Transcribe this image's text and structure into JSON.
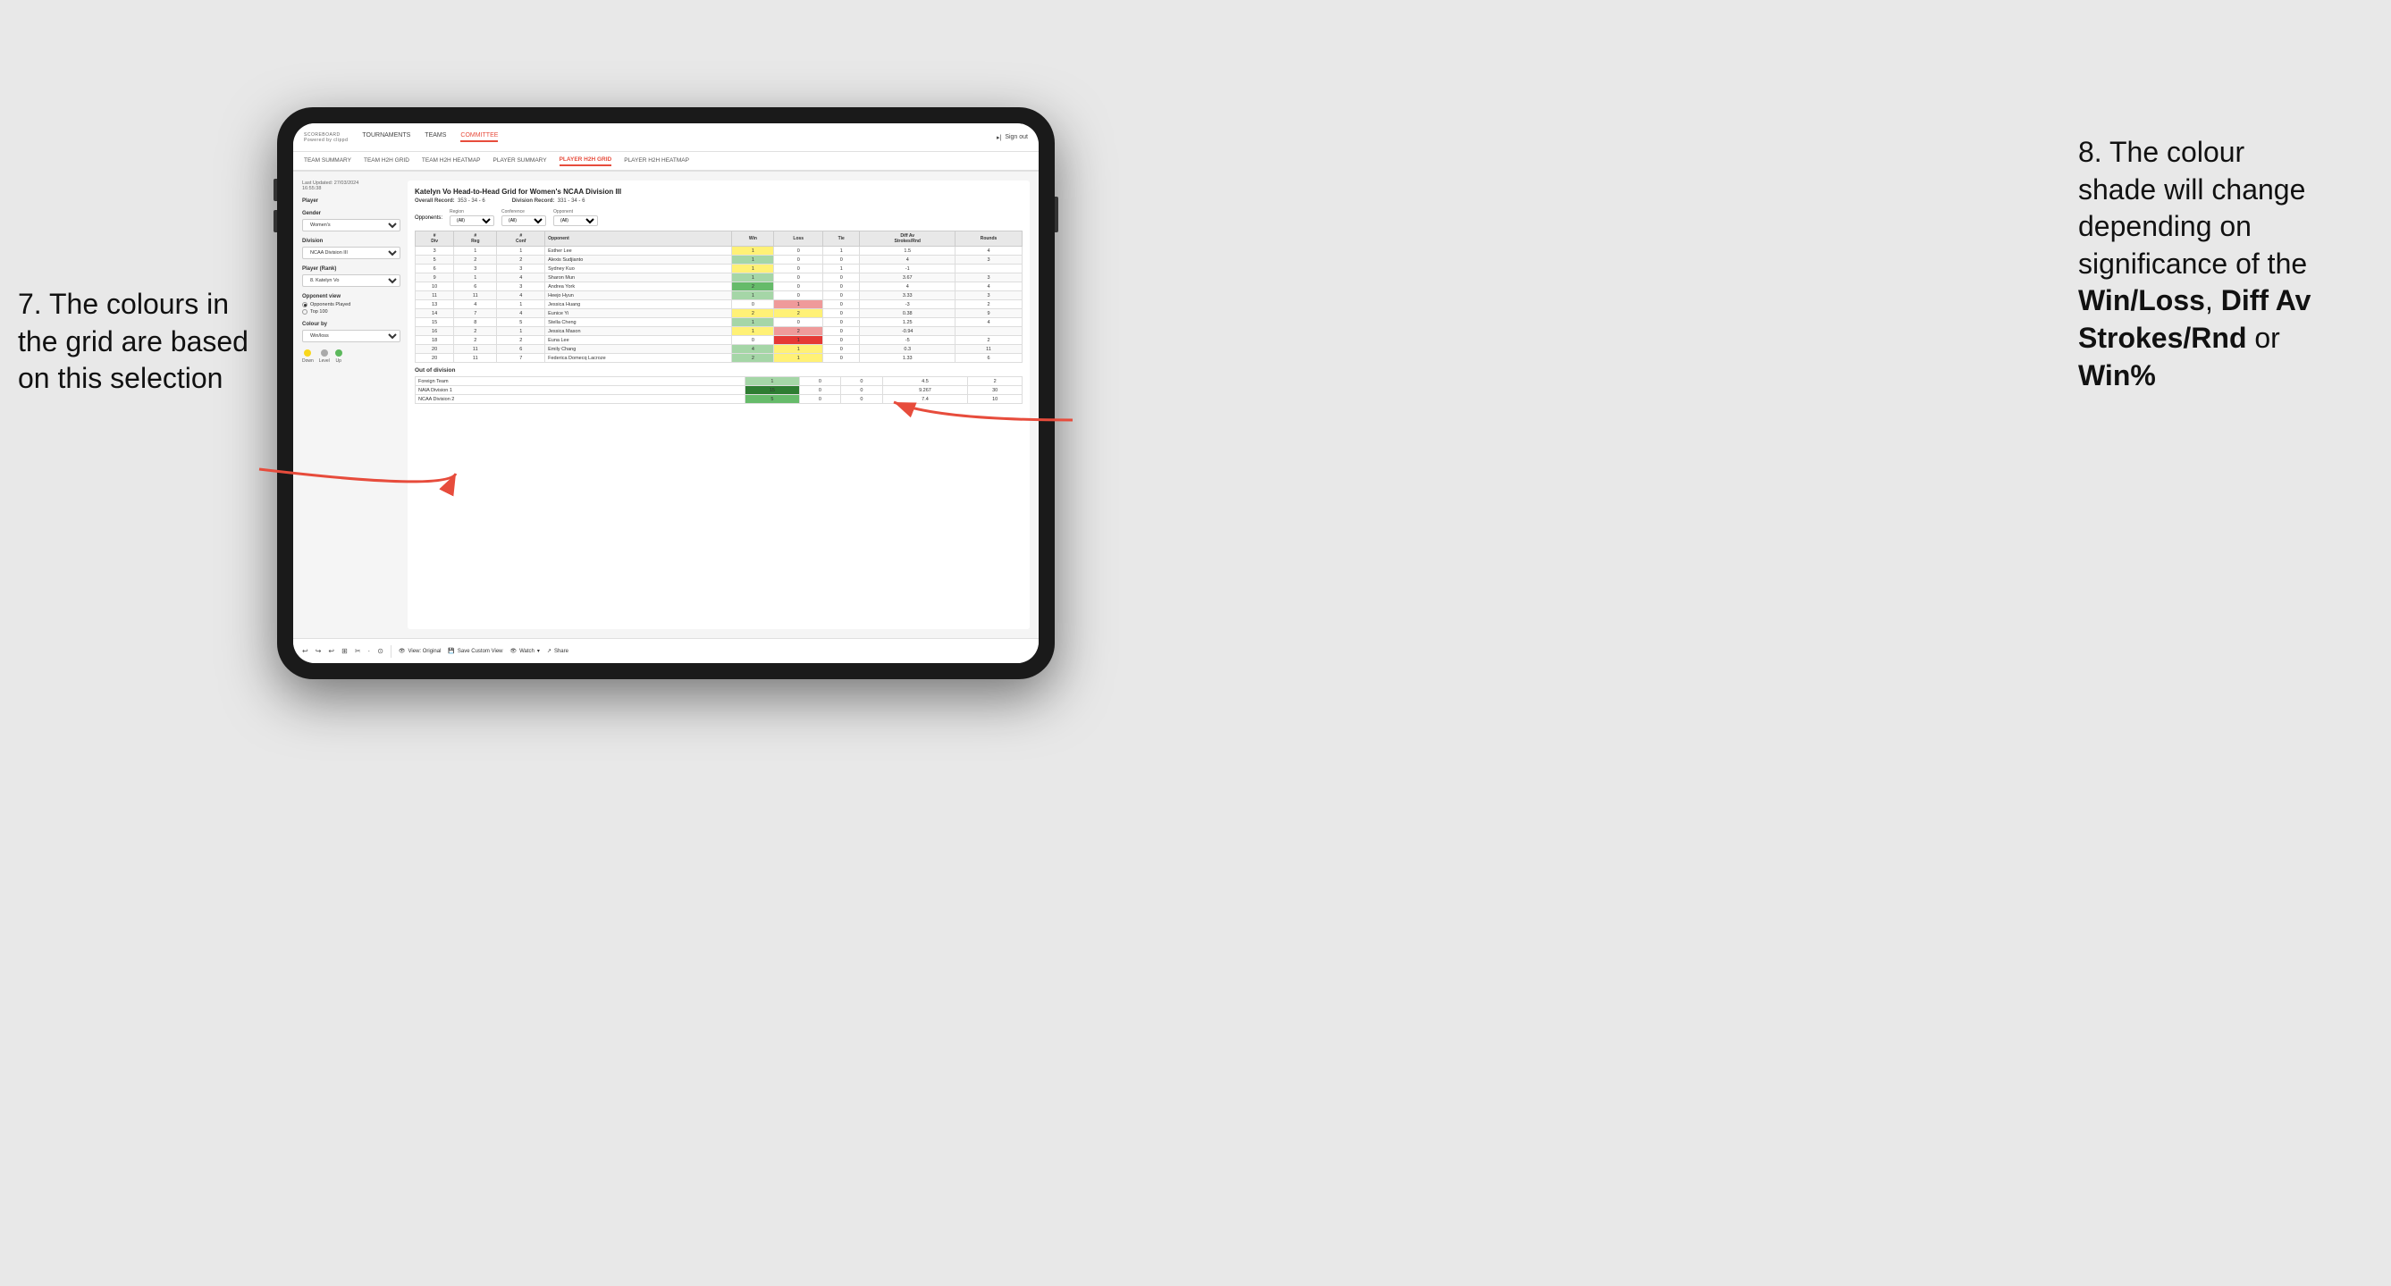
{
  "annotations": {
    "left": {
      "line1": "7. The colours in",
      "line2": "the grid are based",
      "line3": "on this selection"
    },
    "right": {
      "line1": "8. The colour",
      "line2": "shade will change",
      "line3": "depending on",
      "line4": "significance of the",
      "win_loss": "Win/Loss",
      "comma1": ", ",
      "diff": "Diff Av",
      "strokes": "Strokes/Rnd",
      "or": " or",
      "win_pct": "Win%"
    }
  },
  "nav": {
    "logo": "SCOREBOARD",
    "logo_sub": "Powered by clippd",
    "links": [
      "TOURNAMENTS",
      "TEAMS",
      "COMMITTEE"
    ],
    "active_link": "COMMITTEE",
    "sign_out": "Sign out"
  },
  "sub_nav": {
    "items": [
      "TEAM SUMMARY",
      "TEAM H2H GRID",
      "TEAM H2H HEATMAP",
      "PLAYER SUMMARY",
      "PLAYER H2H GRID",
      "PLAYER H2H HEATMAP"
    ],
    "active": "PLAYER H2H GRID"
  },
  "left_panel": {
    "last_updated_label": "Last Updated: 27/03/2024",
    "last_updated_time": "16:55:38",
    "player_label": "Player",
    "gender_label": "Gender",
    "gender_value": "Women's",
    "division_label": "Division",
    "division_value": "NCAA Division III",
    "player_rank_label": "Player (Rank)",
    "player_rank_value": "8. Katelyn Vo",
    "opponent_view_label": "Opponent view",
    "radio_options": [
      "Opponents Played",
      "Top 100"
    ],
    "selected_radio": "Opponents Played",
    "colour_by_label": "Colour by",
    "colour_by_value": "Win/loss",
    "legend": {
      "down_color": "#f9d71c",
      "level_color": "#aaaaaa",
      "up_color": "#5cb85c",
      "down_label": "Down",
      "level_label": "Level",
      "up_label": "Up"
    }
  },
  "grid": {
    "title": "Katelyn Vo Head-to-Head Grid for Women's NCAA Division III",
    "overall_record_label": "Overall Record:",
    "overall_record": "353 - 34 - 6",
    "division_record_label": "Division Record:",
    "division_record": "331 - 34 - 6",
    "filter_region_label": "Region",
    "filter_region_value": "(All)",
    "filter_conference_label": "Conference",
    "filter_conference_value": "(All)",
    "filter_opponent_label": "Opponent",
    "filter_opponent_value": "(All)",
    "opponents_label": "Opponents:",
    "table_headers": {
      "div": "#\nDiv",
      "reg": "#\nReg",
      "conf": "#\nConf",
      "opponent": "Opponent",
      "win": "Win",
      "loss": "Loss",
      "tie": "Tie",
      "diff_av": "Diff Av\nStrokes/Rnd",
      "rounds": "Rounds"
    },
    "rows": [
      {
        "div": 3,
        "reg": 1,
        "conf": 1,
        "opponent": "Esther Lee",
        "win": 1,
        "loss": 0,
        "tie": 1,
        "diff": 1.5,
        "rounds": 4,
        "win_class": "cell-yellow",
        "loss_class": "cell-white",
        "tie_class": "cell-white"
      },
      {
        "div": 5,
        "reg": 2,
        "conf": 2,
        "opponent": "Alexis Sudjianto",
        "win": 1,
        "loss": 0,
        "tie": 0,
        "diff": 4.0,
        "rounds": 3,
        "win_class": "cell-green-light",
        "loss_class": "cell-white",
        "tie_class": "cell-white"
      },
      {
        "div": 6,
        "reg": 3,
        "conf": 3,
        "opponent": "Sydney Kuo",
        "win": 1,
        "loss": 0,
        "tie": 1,
        "diff": -1.0,
        "rounds": "",
        "win_class": "cell-yellow",
        "loss_class": "cell-white",
        "tie_class": "cell-white"
      },
      {
        "div": 9,
        "reg": 1,
        "conf": 4,
        "opponent": "Sharon Mun",
        "win": 1,
        "loss": 0,
        "tie": 0,
        "diff": 3.67,
        "rounds": 3,
        "win_class": "cell-green-light",
        "loss_class": "cell-white",
        "tie_class": "cell-white"
      },
      {
        "div": 10,
        "reg": 6,
        "conf": 3,
        "opponent": "Andrea York",
        "win": 2,
        "loss": 0,
        "tie": 0,
        "diff": 4.0,
        "rounds": 4,
        "win_class": "cell-green-medium",
        "loss_class": "cell-white",
        "tie_class": "cell-white"
      },
      {
        "div": 11,
        "reg": 11,
        "conf": 4,
        "opponent": "Heejo Hyun",
        "win": 1,
        "loss": 0,
        "tie": 0,
        "diff": 3.33,
        "rounds": 3,
        "win_class": "cell-green-light",
        "loss_class": "cell-white",
        "tie_class": "cell-white"
      },
      {
        "div": 13,
        "reg": 4,
        "conf": 1,
        "opponent": "Jessica Huang",
        "win": 0,
        "loss": 1,
        "tie": 0,
        "diff": -3.0,
        "rounds": 2,
        "win_class": "cell-white",
        "loss_class": "cell-red-light",
        "tie_class": "cell-white"
      },
      {
        "div": 14,
        "reg": 7,
        "conf": 4,
        "opponent": "Eunice Yi",
        "win": 2,
        "loss": 2,
        "tie": 0,
        "diff": 0.38,
        "rounds": 9,
        "win_class": "cell-yellow",
        "loss_class": "cell-yellow",
        "tie_class": "cell-white"
      },
      {
        "div": 15,
        "reg": 8,
        "conf": 5,
        "opponent": "Stella Cheng",
        "win": 1,
        "loss": 0,
        "tie": 0,
        "diff": 1.25,
        "rounds": 4,
        "win_class": "cell-green-light",
        "loss_class": "cell-white",
        "tie_class": "cell-white"
      },
      {
        "div": 16,
        "reg": 2,
        "conf": 1,
        "opponent": "Jessica Mason",
        "win": 1,
        "loss": 2,
        "tie": 0,
        "diff": -0.94,
        "rounds": "",
        "win_class": "cell-yellow",
        "loss_class": "cell-red-light",
        "tie_class": "cell-white"
      },
      {
        "div": 18,
        "reg": 2,
        "conf": 2,
        "opponent": "Euna Lee",
        "win": 0,
        "loss": 1,
        "tie": 0,
        "diff": -5.0,
        "rounds": 2,
        "win_class": "cell-white",
        "loss_class": "cell-red-medium",
        "tie_class": "cell-white"
      },
      {
        "div": 20,
        "reg": 11,
        "conf": 6,
        "opponent": "Emily Chang",
        "win": 4,
        "loss": 1,
        "tie": 0,
        "diff": 0.3,
        "rounds": 11,
        "win_class": "cell-green-light",
        "loss_class": "cell-yellow",
        "tie_class": "cell-white"
      },
      {
        "div": 20,
        "reg": 11,
        "conf": 7,
        "opponent": "Federica Domecq Lacroze",
        "win": 2,
        "loss": 1,
        "tie": 0,
        "diff": 1.33,
        "rounds": 6,
        "win_class": "cell-green-light",
        "loss_class": "cell-yellow",
        "tie_class": "cell-white"
      }
    ],
    "out_of_division_label": "Out of division",
    "out_of_division_rows": [
      {
        "label": "Foreign Team",
        "win": 1,
        "loss": 0,
        "tie": 0,
        "diff": 4.5,
        "rounds": 2,
        "win_class": "cell-green-light"
      },
      {
        "label": "NAIA Division 1",
        "win": 15,
        "loss": 0,
        "tie": 0,
        "diff": 9.267,
        "rounds": 30,
        "win_class": "cell-green-strong"
      },
      {
        "label": "NCAA Division 2",
        "win": 5,
        "loss": 0,
        "tie": 0,
        "diff": 7.4,
        "rounds": 10,
        "win_class": "cell-green-medium"
      }
    ]
  },
  "toolbar": {
    "icons": [
      "↩",
      "↪",
      "↩",
      "⊞",
      "✂",
      "·",
      "⊙",
      "|"
    ],
    "view_original": "View: Original",
    "save_custom": "Save Custom View",
    "watch": "Watch",
    "share": "Share"
  }
}
